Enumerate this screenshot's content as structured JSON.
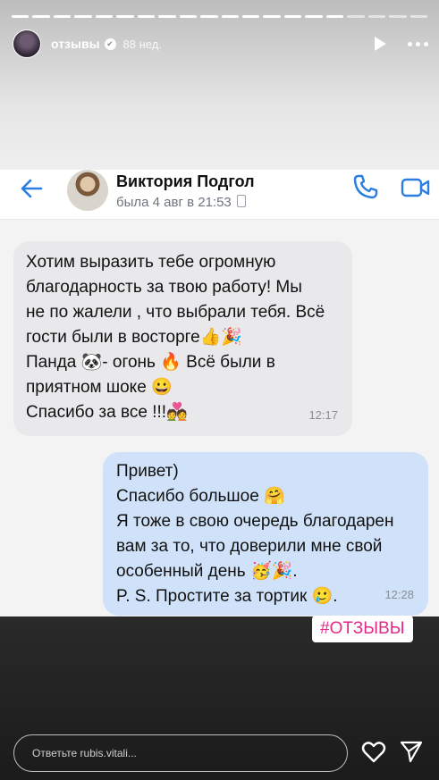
{
  "story": {
    "username": "отзывы",
    "time_ago": "88 нед.",
    "progress_total": 20,
    "progress_done": 16,
    "hashtag": "#ОТЗЫВЫ",
    "reply_placeholder": "Ответьте rubis.vitali..."
  },
  "chat": {
    "contact_name": "Виктория Подгол",
    "last_seen": "была 4 авг в 21:53",
    "accent_color": "#2a7de1",
    "messages": [
      {
        "direction": "incoming",
        "lines": [
          "Хотим выразить тебе огромную",
          "благодарность за твою работу! Мы",
          "не по жалели , что выбрали тебя. Всё",
          "гости  были в восторге👍🎉",
          "Панда 🐼- огонь 🔥 Всё были в",
          "приятном шоке 😀",
          "Спасибо за все !!!💑"
        ],
        "time": "12:17"
      },
      {
        "direction": "outgoing",
        "lines": [
          "Привет)",
          "Спасибо большое 🤗",
          "Я тоже в свою очередь благодарен",
          "вам за то, что доверили  мне свой",
          "особенный день 🥳🎉.",
          "P. S. Простите за тортик 🥲."
        ],
        "time": "12:28"
      }
    ]
  }
}
